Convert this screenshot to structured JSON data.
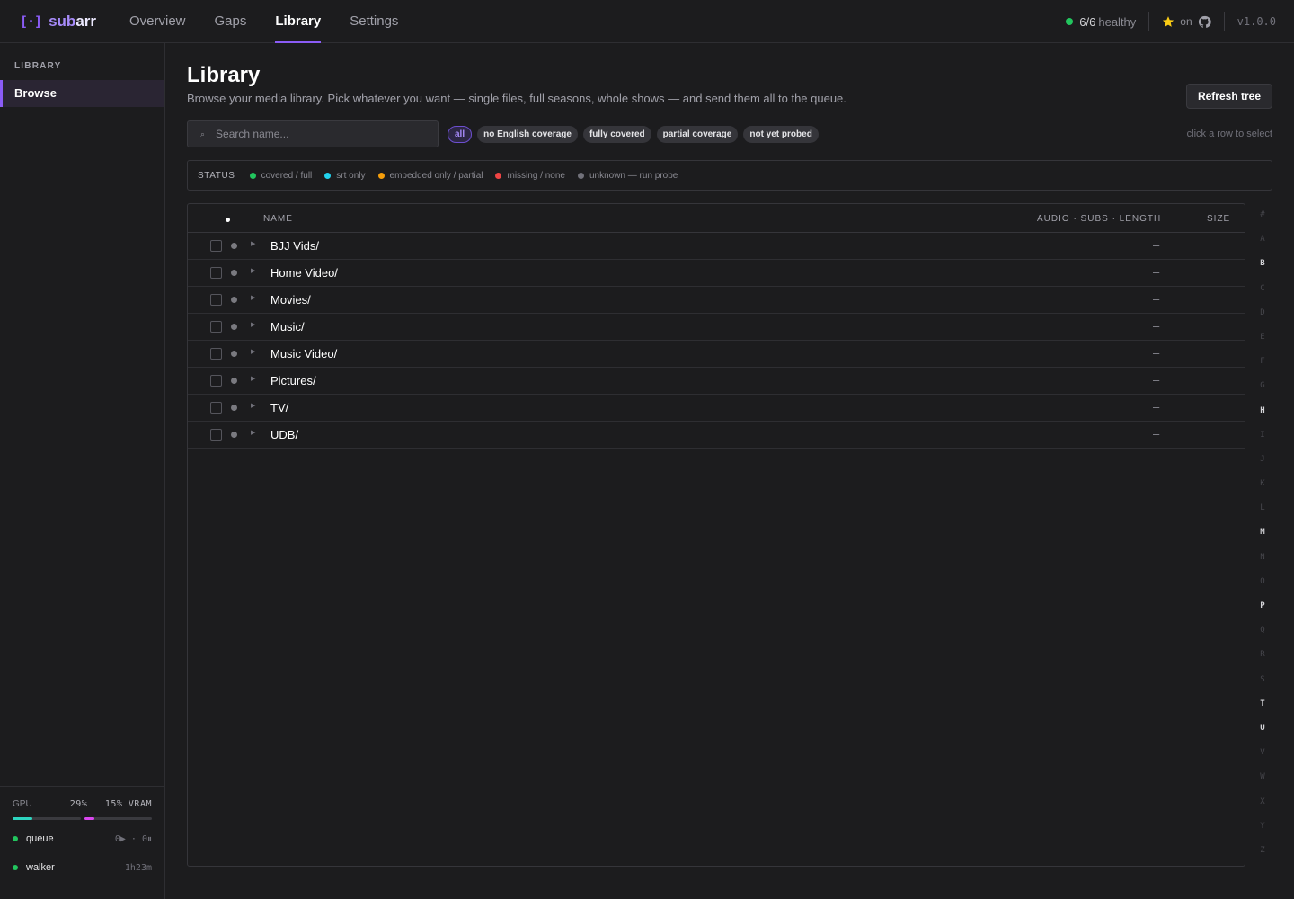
{
  "app": {
    "logo_mark": "[·]",
    "name_a": "sub",
    "name_b": "arr"
  },
  "nav": {
    "tabs": [
      {
        "label": "Overview"
      },
      {
        "label": "Gaps"
      },
      {
        "label": "Library",
        "active": true
      },
      {
        "label": "Settings"
      }
    ]
  },
  "header_right": {
    "health_count": "6/6",
    "health_label": "healthy",
    "star_label": "on",
    "version": "v1.0.0"
  },
  "sidebar": {
    "heading": "LIBRARY",
    "items": [
      {
        "label": "Browse",
        "active": true
      }
    ],
    "gpu": {
      "label": "GPU",
      "gpu_pct": "29%",
      "vram_pct": "15%",
      "vram_label": "VRAM",
      "gpu_fraction": 0.29,
      "vram_fraction": 0.15
    },
    "services": [
      {
        "name": "queue",
        "meta": "0▶ · 0⏸"
      },
      {
        "name": "walker",
        "meta": "1h23m"
      }
    ]
  },
  "page": {
    "title": "Library",
    "subtitle": "Browse your media library. Pick whatever you want — single files, full seasons, whole shows — and send them all to the queue.",
    "refresh_label": "Refresh tree"
  },
  "search": {
    "placeholder": "Search name..."
  },
  "filters": [
    "all",
    "no English coverage",
    "fully covered",
    "partial coverage",
    "not yet probed"
  ],
  "hint": "click a row to select",
  "status_legend": {
    "label": "STATUS",
    "items": [
      {
        "label": "covered / full",
        "color": "#22c55e"
      },
      {
        "label": "srt only",
        "color": "#22d3ee"
      },
      {
        "label": "embedded only / partial",
        "color": "#f59e0b"
      },
      {
        "label": "missing / none",
        "color": "#ef4444"
      },
      {
        "label": "unknown — run probe",
        "color": "#71717a"
      }
    ]
  },
  "table": {
    "columns": {
      "name": "NAME",
      "meta": "AUDIO · SUBS · LENGTH",
      "size": "SIZE"
    },
    "rows": [
      {
        "name": "BJJ Vids/",
        "meta": "–"
      },
      {
        "name": "Home Video/",
        "meta": "–"
      },
      {
        "name": "Movies/",
        "meta": "–"
      },
      {
        "name": "Music/",
        "meta": "–"
      },
      {
        "name": "Music Video/",
        "meta": "–"
      },
      {
        "name": "Pictures/",
        "meta": "–"
      },
      {
        "name": "TV/",
        "meta": "–"
      },
      {
        "name": "UDB/",
        "meta": "–"
      }
    ]
  },
  "alpha_index": {
    "letters": [
      "#",
      "A",
      "B",
      "C",
      "D",
      "E",
      "F",
      "G",
      "H",
      "I",
      "J",
      "K",
      "L",
      "M",
      "N",
      "O",
      "P",
      "Q",
      "R",
      "S",
      "T",
      "U",
      "V",
      "W",
      "X",
      "Y",
      "Z"
    ],
    "active": [
      "B",
      "H",
      "M",
      "P",
      "T",
      "U"
    ]
  },
  "colors": {
    "accent": "#8b5cf6",
    "health": "#22c55e",
    "gpu_bar": "#2dd4bf",
    "vram_bar": "#d946ef",
    "star": "#facc15"
  }
}
